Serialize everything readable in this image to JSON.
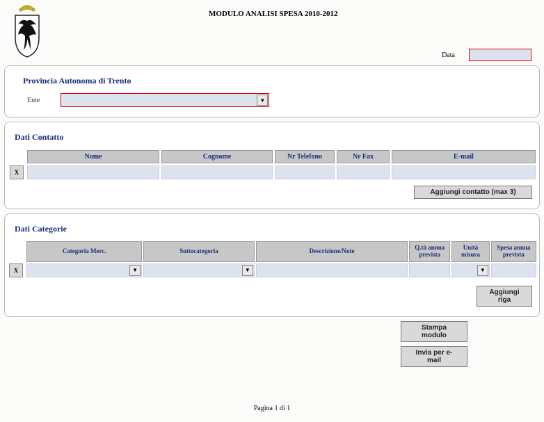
{
  "header": {
    "title": "MODULO ANALISI SPESA  2010-2012",
    "date_label": "Data",
    "date_value": ""
  },
  "ente": {
    "section_title": "Provincia Autonoma di Trento",
    "label": "Ente",
    "value": ""
  },
  "contatto": {
    "section_title": "Dati Contatto",
    "columns": [
      "Nome",
      "Cognome",
      "Nr Telefono",
      "Nr Fax",
      "E-mail"
    ],
    "rows": [
      {
        "nome": "",
        "cognome": "",
        "telefono": "",
        "fax": "",
        "email": ""
      }
    ],
    "del_label": "X",
    "add_label": "Aggiungi contatto (max 3)"
  },
  "categorie": {
    "section_title": "Dati Categorie",
    "columns": [
      "Categoria Merc.",
      "Sottocategoria",
      "Descrizione/Note",
      "Q.tà annua prevista",
      "Unità misura",
      "Spesa annua prevista"
    ],
    "rows": [
      {
        "categoria": "",
        "sotto": "",
        "descr": "",
        "qta": "",
        "unita": "",
        "spesa": ""
      }
    ],
    "del_label": "X",
    "add_label": "Aggiungi riga"
  },
  "actions": {
    "stampa": "Stampa modulo",
    "invia": "Invia per e-mail"
  },
  "footer": {
    "page": "Pagina 1 di 1"
  }
}
